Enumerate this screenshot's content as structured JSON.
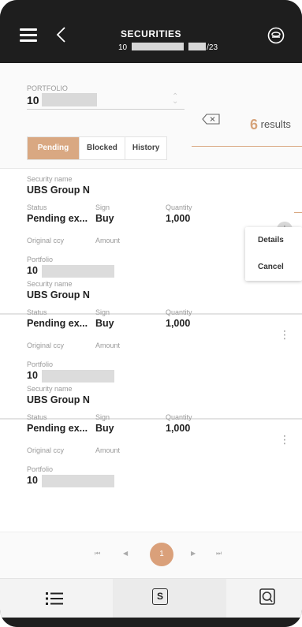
{
  "header": {
    "title": "SECURITIES",
    "subtitle_prefix": "10",
    "subtitle_suffix": "/23"
  },
  "filter": {
    "portfolio_label": "PORTFOLIO",
    "portfolio_value": "10",
    "results_count": "6",
    "results_label": "results",
    "tabs": [
      {
        "label": "Pending",
        "active": true
      },
      {
        "label": "Blocked",
        "active": false
      },
      {
        "label": "History",
        "active": false
      }
    ]
  },
  "labels": {
    "security_name": "Security name",
    "status": "Status",
    "sign": "Sign",
    "quantity": "Quantity",
    "original_ccy": "Original ccy",
    "amount": "Amount",
    "portfolio": "Portfolio"
  },
  "items": [
    {
      "security_name": "UBS Group N",
      "status": "Pending ex...",
      "sign": "Buy",
      "quantity": "1,000",
      "portfolio": "10"
    },
    {
      "security_name": "UBS Group N",
      "status": "Pending ex...",
      "sign": "Buy",
      "quantity": "1,000",
      "portfolio": "10"
    },
    {
      "security_name": "UBS Group N",
      "status": "Pending ex...",
      "sign": "Buy",
      "quantity": "1,000",
      "portfolio": "10"
    }
  ],
  "context_menu": {
    "details": "Details",
    "cancel": "Cancel"
  },
  "pager": {
    "current_page": "1",
    "first": "⏮",
    "prev": "◀",
    "next": "▶",
    "last": "⏭"
  },
  "kebab_glyph": "⋮",
  "accent_color": "#d9a882"
}
